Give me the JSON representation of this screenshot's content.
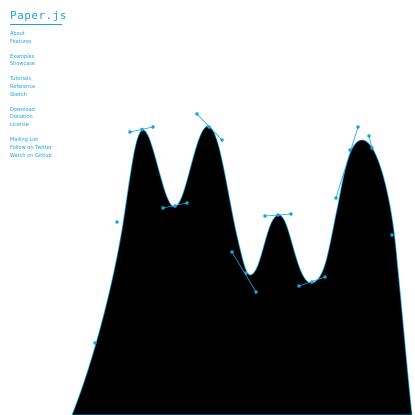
{
  "brand": {
    "logo_text": "Paper.js"
  },
  "nav": {
    "groups": [
      [
        "About",
        "Features"
      ],
      [
        "Examples",
        "Showcase"
      ],
      [
        "Tutorials",
        "Reference",
        "Sketch"
      ],
      [
        "Download",
        "Donation",
        "License"
      ],
      [
        "Mailing List",
        "Follow on Twitter",
        "Watch on Github"
      ]
    ]
  },
  "colors": {
    "accent": "#1aa3de",
    "fill": "#000000",
    "background": "#ffffff"
  }
}
